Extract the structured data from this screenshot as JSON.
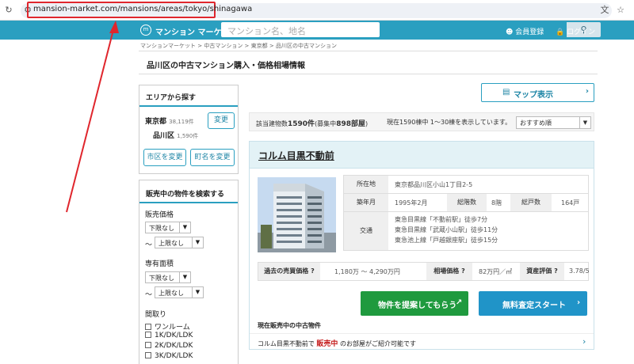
{
  "browser": {
    "url": "mansion-market.com/mansions/areas/tokyo/shinagawa",
    "icons": [
      "reload-icon",
      "site-info-icon",
      "translate-icon",
      "bookmark-star-icon"
    ]
  },
  "header": {
    "logo_text": "マンション マーケット",
    "logo_mark": "m",
    "search_placeholder": "マンション名、地名",
    "register_label": "会員登録",
    "login_label": "ログイン",
    "brand_color": "#2a9fc0"
  },
  "breadcrumb": "マンションマーケット > 中古マンション > 東京都 > 品川区の中古マンション",
  "page_title": "品川区の中古マンション購入・価格相場情報",
  "sidebar": {
    "area": {
      "heading": "エリアから探す",
      "pref": "東京都",
      "pref_count": "38,119件",
      "ward": "品川区",
      "ward_count": "1,590件",
      "change_btn": "変更",
      "change_city_btn": "市区を変更",
      "change_town_btn": "町名を変更"
    },
    "search": {
      "heading": "販売中の物件を検索する",
      "price_label": "販売価格",
      "price_min": "下限なし",
      "price_max": "上限なし",
      "area_label": "専有面積",
      "area_min": "下限なし",
      "area_max": "上限なし",
      "tilde": "〜",
      "layout_label": "間取り",
      "layouts": [
        "ワンルーム",
        "1K/DK/LDK",
        "2K/DK/LDK",
        "3K/DK/LDK"
      ]
    }
  },
  "main": {
    "map_button": "マップ表示",
    "count_prefix": "該当建物数",
    "count_value": "1590件",
    "count_suffix_open": "(募集中",
    "count_selling": "898部屋",
    "count_suffix_close": ")",
    "showing": "現在1590棟中 1〜30棟を表示しています。",
    "sort": "おすすめ順",
    "listing": {
      "name": "コルム目黒不動前",
      "address_label": "所在地",
      "address": "東京都品川区小山1丁目2-5",
      "built_label": "築年月",
      "built": "1995年2月",
      "floors_label": "総階数",
      "floors": "8階",
      "units_label": "総戸数",
      "units": "164戸",
      "transport_label": "交通",
      "transport": [
        "東急目黒線「不動前駅」徒歩7分",
        "東急目黒線「武蔵小山駅」徒歩11分",
        "東急池上線「戸越銀座駅」徒歩15分"
      ],
      "past_price_label": "過去の売買価格",
      "past_price": "1,180万 〜 4,290万円",
      "market_label": "相場価格",
      "market": "82万円／㎡",
      "rating_label": "資産評価",
      "rating": "3.78",
      "rating_suffix": "/5",
      "cta_offer": "物件を提案してもらう",
      "cta_assess": "無料査定スタート",
      "now_selling_heading": "現在販売中の中古物件",
      "now_selling_prefix": "コルム目黒不動前で",
      "now_selling_word": "販売中",
      "now_selling_suffix": "のお部屋がご紹介可能です"
    }
  }
}
